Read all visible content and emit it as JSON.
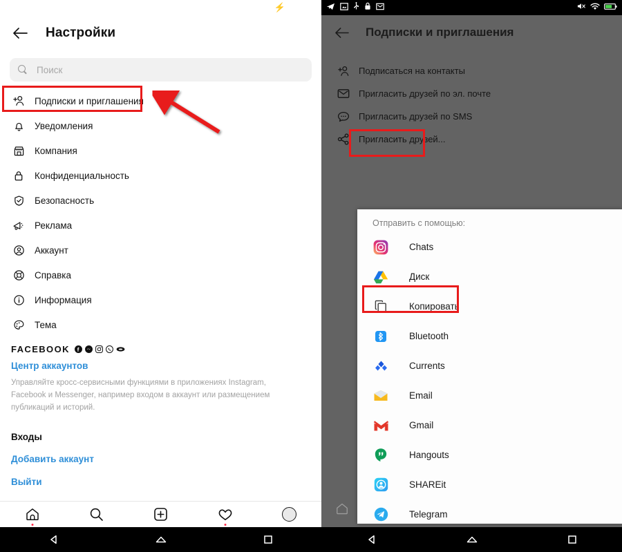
{
  "left_phone": {
    "statusbar": {
      "charging_icon": "lightning-bolt-icon"
    },
    "header": {
      "back_icon": "back-arrow-icon",
      "title": "Настройки"
    },
    "search": {
      "icon": "search-icon",
      "placeholder": "Поиск",
      "value": ""
    },
    "menu_items": [
      {
        "icon": "add-person-icon",
        "label": "Подписки и приглашения",
        "highlighted": true
      },
      {
        "icon": "bell-icon",
        "label": "Уведомления"
      },
      {
        "icon": "storefront-icon",
        "label": "Компания"
      },
      {
        "icon": "lock-icon",
        "label": "Конфиденциальность"
      },
      {
        "icon": "shield-check-icon",
        "label": "Безопасность"
      },
      {
        "icon": "megaphone-icon",
        "label": "Реклама"
      },
      {
        "icon": "account-circle-icon",
        "label": "Аккаунт"
      },
      {
        "icon": "lifebuoy-icon",
        "label": "Справка"
      },
      {
        "icon": "info-circle-icon",
        "label": "Информация"
      },
      {
        "icon": "palette-icon",
        "label": "Тема"
      }
    ],
    "facebook_section": {
      "label": "FACEBOOK",
      "badges": [
        "facebook-icon",
        "messenger-icon",
        "instagram-icon",
        "whatsapp-icon",
        "portal-icon"
      ],
      "accounts_center_link": "Центр аккаунтов",
      "description": "Управляйте кросс-сервисными функциями в приложениях Instagram, Facebook и Messenger, например входом в аккаунт или размещением публикаций и историй."
    },
    "logins_section": {
      "heading": "Входы",
      "add_account_link": "Добавить аккаунт",
      "logout_link": "Выйти"
    },
    "bottom_nav": [
      {
        "icon": "home-icon",
        "badge": true
      },
      {
        "icon": "search-icon",
        "badge": false
      },
      {
        "icon": "add-square-icon",
        "badge": false
      },
      {
        "icon": "heart-icon",
        "badge": true
      },
      {
        "icon": "avatar-icon",
        "badge": false
      }
    ],
    "android_nav": [
      {
        "icon": "back-triangle-icon"
      },
      {
        "icon": "home-triangle-icon"
      },
      {
        "icon": "recents-square-icon"
      }
    ]
  },
  "right_phone": {
    "statusbar": {
      "left_icons": [
        "telegram-icon",
        "screenshot-icon",
        "usb-icon",
        "lock-icon",
        "mail-icon"
      ],
      "right_icons": [
        "mute-icon",
        "wifi-icon",
        "battery-icon"
      ]
    },
    "header": {
      "back_icon": "back-arrow-icon",
      "title": "Подписки и приглашения"
    },
    "menu_items": [
      {
        "icon": "add-person-icon",
        "label": "Подписаться на контакты"
      },
      {
        "icon": "envelope-icon",
        "label": "Пригласить друзей по эл. почте"
      },
      {
        "icon": "chat-bubble-icon",
        "label": "Пригласить друзей по SMS"
      },
      {
        "icon": "share-icon",
        "label": "Пригласить друзей...",
        "highlighted": true
      }
    ],
    "share_sheet": {
      "title": "Отправить с помощью:",
      "apps": [
        {
          "icon": "instagram-icon",
          "label": "Chats"
        },
        {
          "icon": "google-drive-icon",
          "label": "Диск"
        },
        {
          "icon": "copy-icon",
          "label": "Копировать",
          "highlighted": true
        },
        {
          "icon": "bluetooth-icon",
          "label": "Bluetooth"
        },
        {
          "icon": "currents-icon",
          "label": "Currents"
        },
        {
          "icon": "email-icon",
          "label": "Email"
        },
        {
          "icon": "gmail-icon",
          "label": "Gmail"
        },
        {
          "icon": "hangouts-icon",
          "label": "Hangouts"
        },
        {
          "icon": "shareit-icon",
          "label": "SHAREit"
        },
        {
          "icon": "telegram-icon",
          "label": "Telegram"
        }
      ]
    },
    "android_nav": [
      {
        "icon": "back-triangle-icon"
      },
      {
        "icon": "home-triangle-icon"
      },
      {
        "icon": "recents-square-icon"
      }
    ]
  },
  "annotations": {
    "color": "#e81b1b",
    "arrows": [
      "arrow-to-subscriptions",
      "arrow-to-invite-friends",
      "arrow-to-copy"
    ],
    "boxes": [
      "box-subscriptions",
      "box-invite-friends",
      "box-copy"
    ]
  }
}
